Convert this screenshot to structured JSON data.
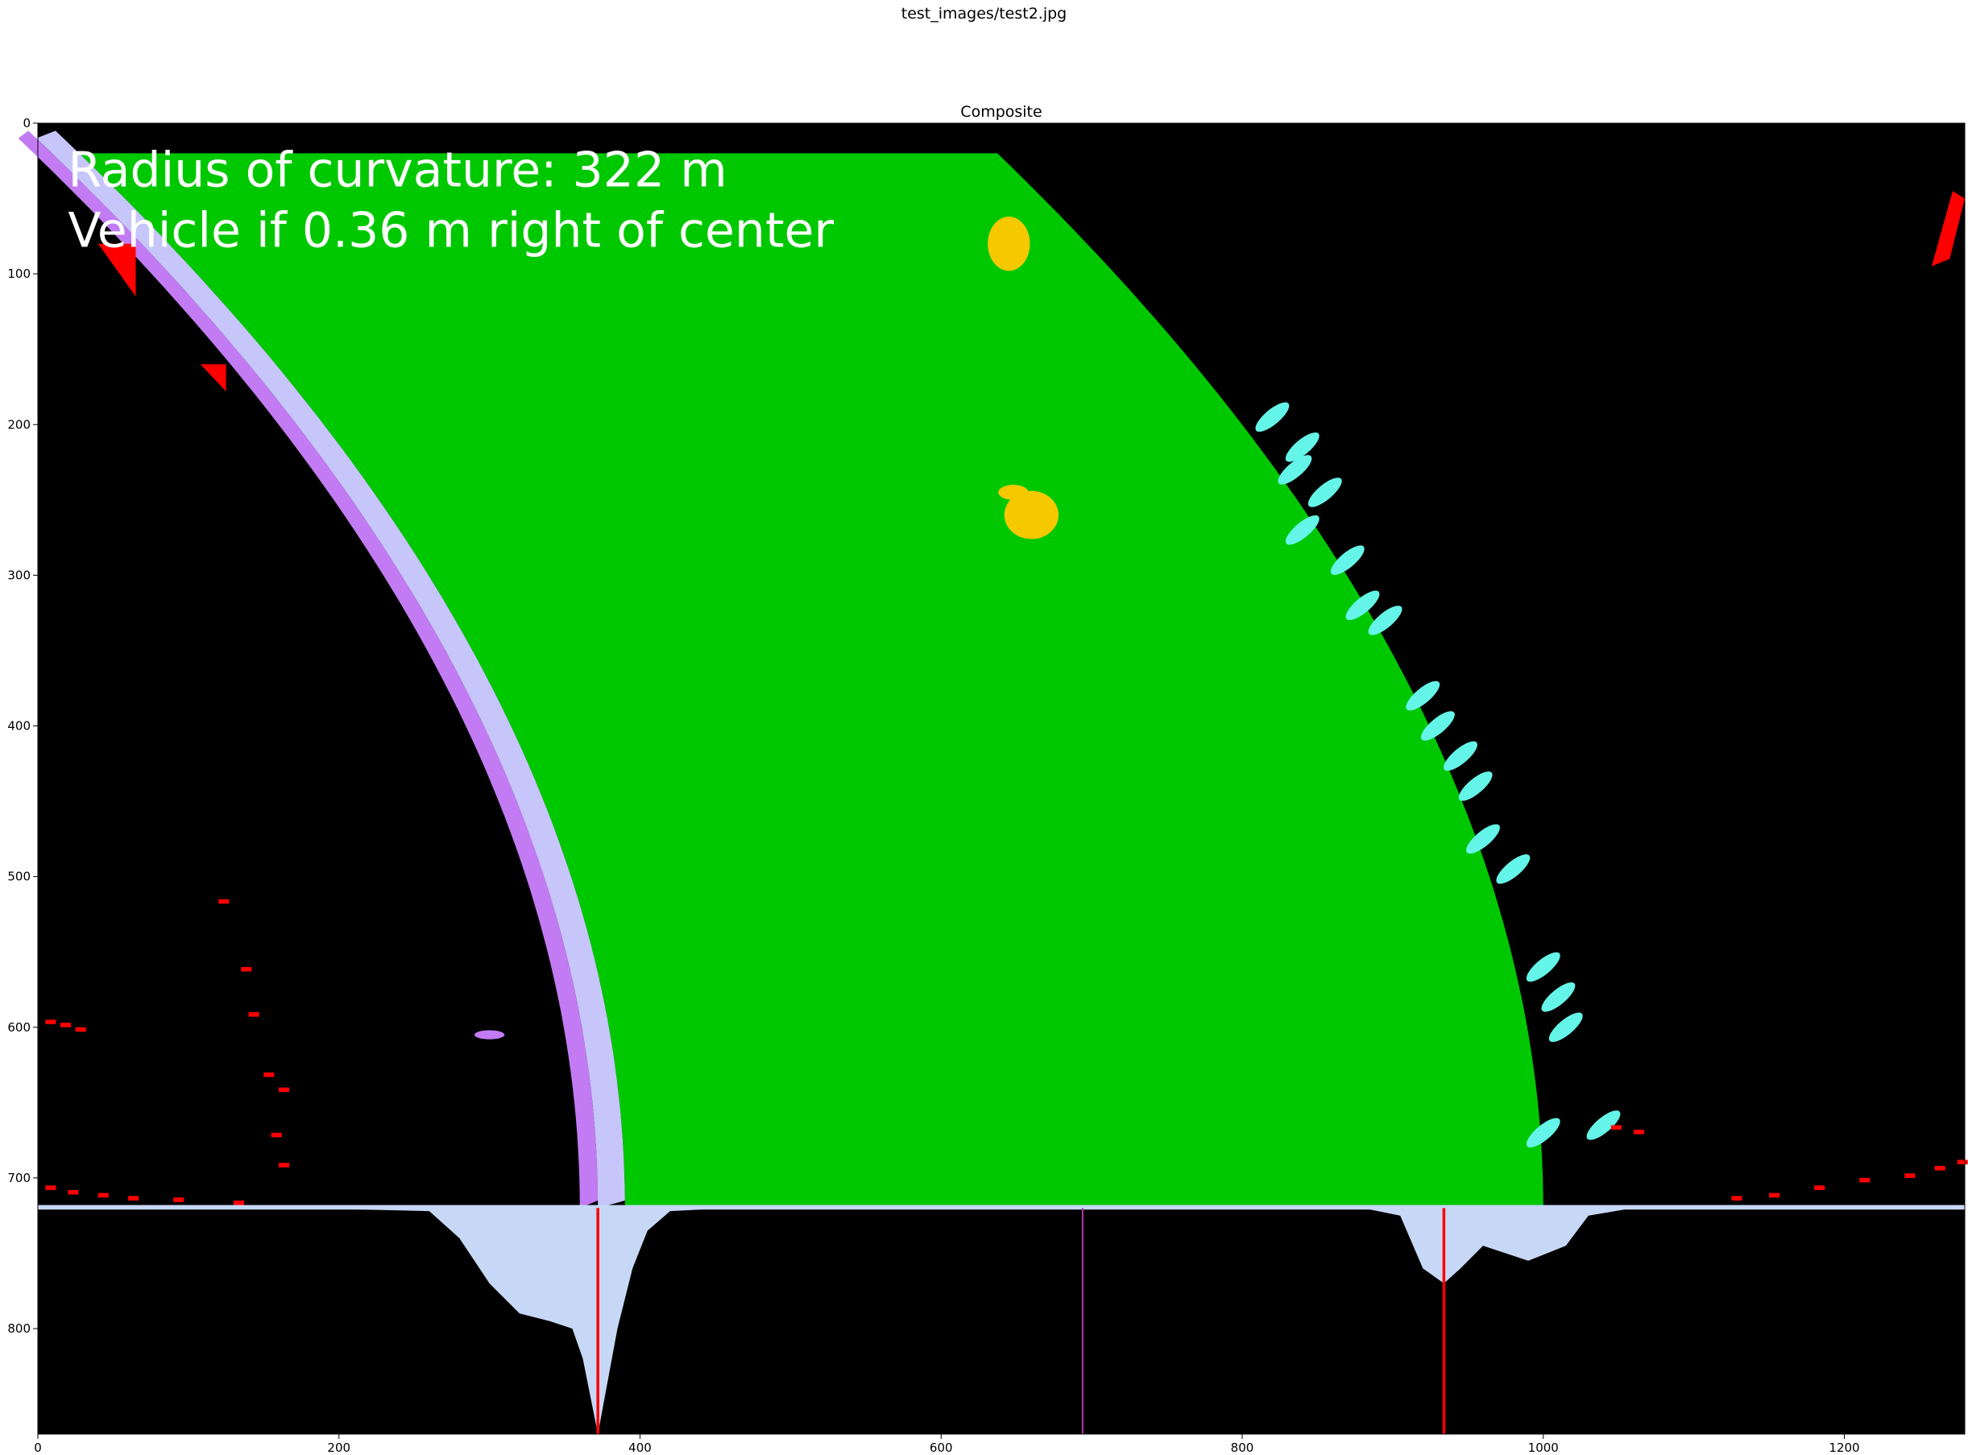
{
  "figure_title": "test_images/test2.jpg",
  "axes_title": "Composite",
  "overlay": {
    "line1": "Radius of curvature: 322 m",
    "line2": "Vehicle if 0.36 m right of center"
  },
  "x_ticks": [
    "0",
    "200",
    "400",
    "600",
    "800",
    "1000",
    "1200"
  ],
  "y_ticks": [
    "0",
    "100",
    "200",
    "300",
    "400",
    "500",
    "600",
    "700",
    "800"
  ],
  "colors": {
    "background": "#000000",
    "lane_fill": "#00c800",
    "left_lane_pixels": "#c27bf2",
    "left_lane_fit": "#c6c6fa",
    "right_lane_pixels": "#64f5e8",
    "noise": "#ff0000",
    "yellow_blobs": "#f5c800",
    "histogram": "#c7d8f6",
    "peak_lines": "#ff0000",
    "center_line": "#b03aa8"
  },
  "chart_data": {
    "type": "heatmap",
    "title": "Composite",
    "xlim": [
      0,
      1280
    ],
    "ylim": [
      870,
      0
    ],
    "x_ticks": [
      0,
      200,
      400,
      600,
      800,
      1000,
      1200
    ],
    "y_ticks": [
      0,
      100,
      200,
      300,
      400,
      500,
      600,
      700,
      800
    ],
    "image_rows": 720,
    "left_peak_x": 372,
    "right_peak_x": 934,
    "center_x": 694,
    "histogram_left_peak_depth": 150,
    "histogram_right_peak_depth": 50
  }
}
